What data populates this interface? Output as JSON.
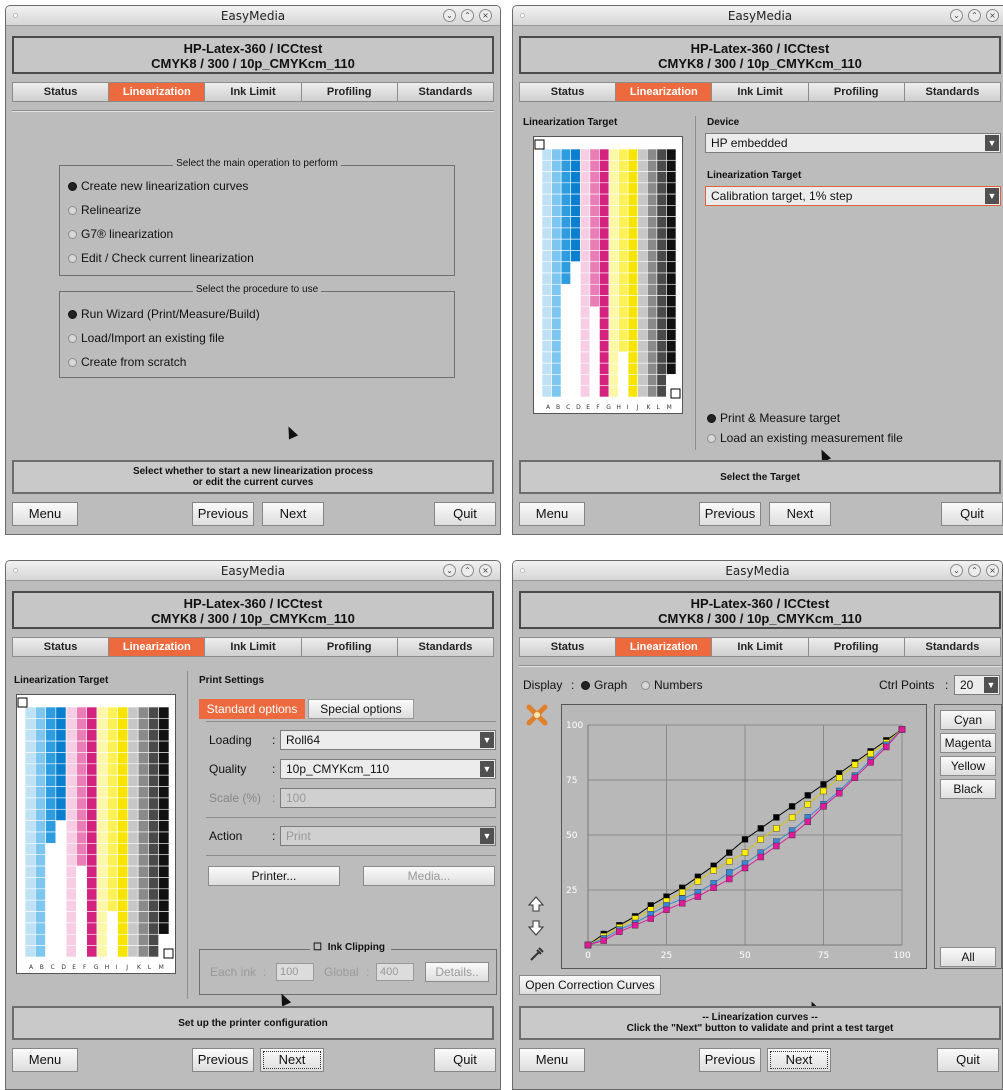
{
  "app_title": "EasyMedia",
  "header_line1": "HP-Latex-360 / ICCtest",
  "header_line2": "CMYK8 / 300 / 10p_CMYKcm_110",
  "tabs": [
    "Status",
    "Linearization",
    "Ink Limit",
    "Profiling",
    "Standards"
  ],
  "buttons": {
    "menu": "Menu",
    "previous": "Previous",
    "next": "Next",
    "quit": "Quit"
  },
  "window_controls": [
    "⌄",
    "⌃",
    "×"
  ],
  "win1": {
    "group1_title": "Select the main operation to perform",
    "ops": [
      "Create new linearization curves",
      "Relinearize",
      "G7® linearization",
      "Edit / Check current linearization"
    ],
    "group2_title": "Select the procedure to use",
    "procs": [
      "Run Wizard (Print/Measure/Build)",
      "Load/Import an existing file",
      "Create from scratch"
    ],
    "status": "Select whether to start a new linearization process\nor edit the current curves"
  },
  "win2": {
    "target_title": "Linearization Target",
    "device_label": "Device",
    "device_value": "HP embedded",
    "lt_label": "Linearization Target",
    "lt_value": "Calibration target, 1% step",
    "radio_print": "Print & Measure target",
    "radio_load": "Load an existing measurement file",
    "status": "Select the Target"
  },
  "win3": {
    "target_title": "Linearization Target",
    "print_settings": "Print Settings",
    "tab_standard": "Standard options",
    "tab_special": "Special options",
    "loading_label": "Loading",
    "loading_value": "Roll64",
    "quality_label": "Quality",
    "quality_value": "10p_CMYKcm_110",
    "scale_label": "Scale (%)",
    "scale_value": "100",
    "action_label": "Action",
    "action_value": "Print",
    "colon": ":",
    "printer_btn": "Printer...",
    "media_btn": "Media...",
    "ink_clipping": "Ink Clipping",
    "each_ink_label": "Each ink",
    "each_ink_value": "100",
    "global_label": "Global",
    "global_value": "400",
    "details_btn": "Details..",
    "status": "Set up the printer configuration"
  },
  "win4": {
    "display_label": "Display",
    "colon": ":",
    "radio_graph": "Graph",
    "radio_numbers": "Numbers",
    "ctrl_points_label": "Ctrl Points",
    "ctrl_points_value": "20",
    "ink_buttons": [
      "Cyan",
      "Magenta",
      "Yellow",
      "Black"
    ],
    "all_btn": "All",
    "open_curves_btn": "Open Correction Curves",
    "status": "-- Linearization curves --\nClick the \"Next\" button to validate and print a test target"
  },
  "target_bottom_labels": [
    "A",
    "B",
    "C",
    "D",
    "E",
    "F",
    "G",
    "H",
    "I",
    "J",
    "K",
    "L",
    "M"
  ],
  "chart_data": {
    "type": "line",
    "xlim": [
      0,
      100
    ],
    "ylim": [
      0,
      100
    ],
    "x_ticks": [
      0,
      25,
      50,
      75,
      100
    ],
    "y_ticks": [
      25,
      50,
      75,
      100
    ],
    "x": [
      0,
      5,
      10,
      15,
      20,
      25,
      30,
      35,
      40,
      45,
      50,
      55,
      60,
      65,
      70,
      75,
      80,
      85,
      90,
      95,
      100
    ],
    "series": [
      {
        "color": "#000000",
        "values": [
          0,
          5,
          9,
          13,
          18,
          22,
          26,
          31,
          36,
          42,
          48,
          53,
          58,
          63,
          68,
          73,
          78,
          83,
          88,
          93,
          98
        ]
      },
      {
        "color": "#ffee00",
        "values": [
          0,
          4,
          8,
          12,
          16,
          20,
          24,
          29,
          34,
          38,
          42,
          48,
          53,
          58,
          64,
          70,
          76,
          82,
          87,
          92,
          98
        ]
      },
      {
        "color": "#3a86d8",
        "values": [
          0,
          3,
          7,
          10,
          14,
          18,
          21,
          24,
          28,
          33,
          37,
          42,
          47,
          52,
          58,
          64,
          70,
          77,
          84,
          91,
          98
        ]
      },
      {
        "color": "#e0199a",
        "values": [
          0,
          2,
          6,
          9,
          12,
          16,
          19,
          22,
          26,
          30,
          35,
          40,
          45,
          50,
          56,
          63,
          69,
          76,
          83,
          90,
          98
        ]
      }
    ]
  }
}
